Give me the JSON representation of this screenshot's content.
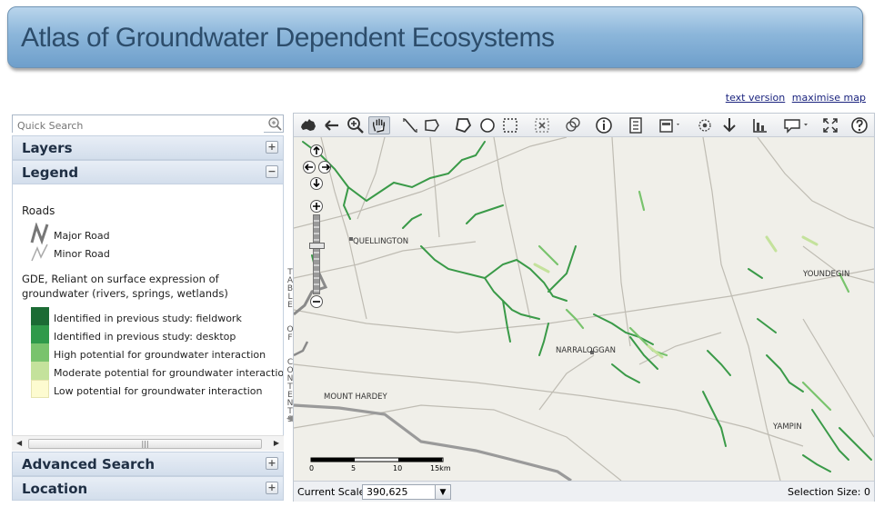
{
  "header": {
    "title": "Atlas of Groundwater Dependent Ecosystems"
  },
  "top_links": {
    "text_version": "text version",
    "maximise_map": "maximise map"
  },
  "search": {
    "placeholder": "Quick Search"
  },
  "panels": {
    "layers": "Layers",
    "legend": "Legend",
    "advanced_search": "Advanced Search",
    "location": "Location",
    "plus_symbol": "+",
    "minus_symbol": "−"
  },
  "legend": {
    "roads_heading": "Roads",
    "roads": [
      {
        "label": "Major Road"
      },
      {
        "label": "Minor Road"
      }
    ],
    "gde_heading_line1": "GDE, Reliant on surface expression of",
    "gde_heading_line2": "groundwater (rivers, springs, wetlands)",
    "classes": [
      {
        "label": "Identified in previous study: fieldwork",
        "color": "#1b6b34"
      },
      {
        "label": "Identified in previous study: desktop",
        "color": "#2f9a4a"
      },
      {
        "label": "High potential for groundwater interaction",
        "color": "#79c36d"
      },
      {
        "label": "Moderate potential for groundwater interaction",
        "color": "#c4e29c"
      },
      {
        "label": "Low potential for groundwater interaction",
        "color": "#fdfbd0"
      }
    ]
  },
  "toc_tab_label": "TABLE OF CONTENTS",
  "map": {
    "towns": [
      "QUELLINGTON",
      "YOUNDEGIN",
      "NARRALOGGAN",
      "MOUNT HARDEY",
      "YAMPIN"
    ],
    "scalebar": {
      "ticks": [
        "0",
        "5",
        "10",
        "15km"
      ]
    }
  },
  "status": {
    "current_scale_label": "Current Scale:",
    "current_scale_value": "390,625",
    "selection_size": "Selection Size: 0"
  },
  "toolbar_tools": [
    "australia-icon",
    "back-icon",
    "zoom-in-icon",
    "pan-hand-icon",
    "measure-line-icon",
    "measure-area-icon",
    "polygon-select-icon",
    "circle-select-icon",
    "box-select-icon",
    "clear-selection-icon",
    "overlay-icon",
    "info-icon",
    "list-icon",
    "print-icon",
    "locate-icon",
    "download-icon",
    "chart-icon",
    "comment-icon",
    "fullscreen-icon",
    "help-icon"
  ]
}
